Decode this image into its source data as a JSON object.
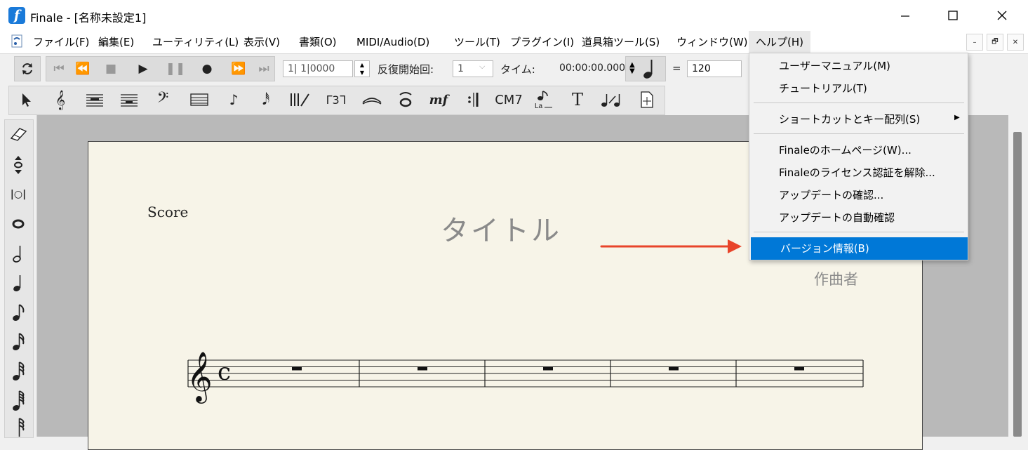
{
  "window": {
    "app_icon_glyph": "f",
    "title": "Finale - [名称未設定1]",
    "minimize_glyph": "—",
    "maximize_glyph": "☐",
    "close_glyph": "✕"
  },
  "menubar": {
    "items": [
      {
        "label": "ファイル(F)"
      },
      {
        "label": "編集(E)"
      },
      {
        "label": "ユーティリティ(L)"
      },
      {
        "label": "表示(V)"
      },
      {
        "label": "書類(O)"
      },
      {
        "label": "MIDI/Audio(D)"
      },
      {
        "label": "ツール(T)"
      },
      {
        "label": "プラグイン(I)"
      },
      {
        "label": "道具箱ツール(S)"
      },
      {
        "label": "ウィンドウ(W)"
      },
      {
        "label": "ヘルプ(H)"
      }
    ],
    "mdi_minimize": "–",
    "mdi_restore": "🗗",
    "mdi_close": "✕"
  },
  "playback": {
    "measure_value": "1| 1|0000",
    "repeat_label": "反復開始回:",
    "repeat_value": "1",
    "time_label": "タイム:",
    "time_value": "00:00:00.000",
    "tempo_equals": "=",
    "tempo_value": "120"
  },
  "main_tools": {
    "chord_label": "CM7",
    "text_tool": "T",
    "dynamics_label": "mf",
    "tuplet_label": "3"
  },
  "score": {
    "part_label": "Score",
    "title": "タイトル",
    "composer": "作曲者",
    "measures": 5,
    "time_signature": "c"
  },
  "help_menu": {
    "items": [
      {
        "label": "ユーザーマニュアル(M)"
      },
      {
        "label": "チュートリアル(T)"
      },
      {
        "label": "ショートカットとキー配列(S)",
        "submenu": true
      },
      {
        "label": "Finaleのホームページ(W)..."
      },
      {
        "label": "Finaleのライセンス認証を解除..."
      },
      {
        "label": "アップデートの確認..."
      },
      {
        "label": "アップデートの自動確認"
      },
      {
        "label": "バージョン情報(B)",
        "highlighted": true
      }
    ],
    "submenu_arrow": "▶"
  },
  "colors": {
    "highlight": "#0078d7",
    "annotation_arrow": "#e8442a",
    "page_paper": "#f7f4e8"
  }
}
